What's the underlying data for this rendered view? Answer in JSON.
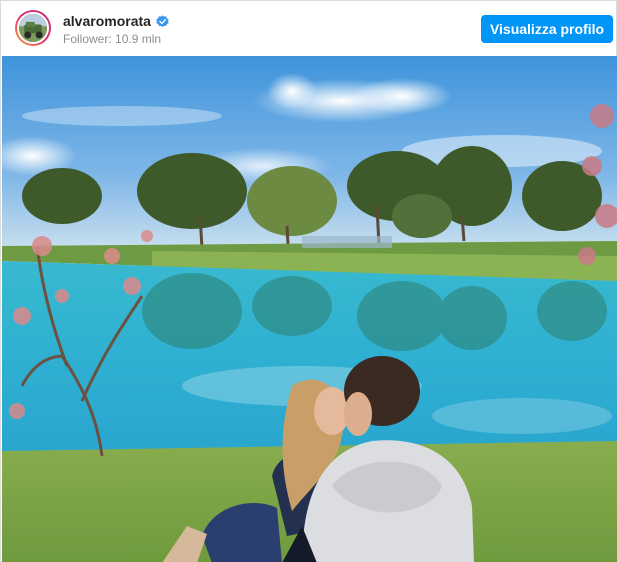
{
  "post": {
    "username": "alvaromorata",
    "verified": true,
    "followers_text": "Follower: 10.9 mln",
    "profile_button_label": "Visualizza profilo"
  },
  "colors": {
    "accent": "#0095f6",
    "verified_badge": "#3897f0",
    "sky": "#4a9fe0",
    "lake": "#33b7d0",
    "grass": "#7fa84a"
  },
  "icons": {
    "verified": "verified-badge-icon"
  },
  "photo": {
    "subject": "couple kissing by a lake"
  }
}
